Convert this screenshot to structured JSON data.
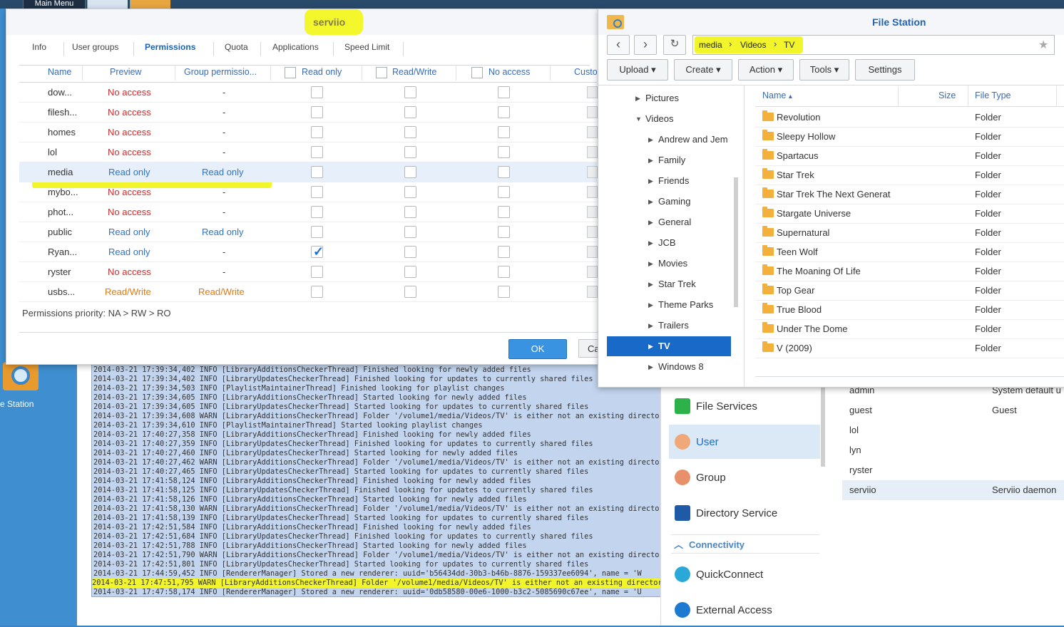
{
  "desktop": {
    "main_menu_label": "Main Menu",
    "file_station_label": "e Station"
  },
  "user_dialog": {
    "title": "serviio",
    "tabs": [
      "Info",
      "User groups",
      "Permissions",
      "Quota",
      "Applications",
      "Speed Limit"
    ],
    "active_tab": "Permissions",
    "columns": {
      "name": "Name",
      "preview": "Preview",
      "group": "Group permissio...",
      "read_only": "Read only",
      "read_write": "Read/Write",
      "no_access": "No access",
      "custom": "Custo"
    },
    "rows": [
      {
        "name": "dow...",
        "preview": "No access",
        "preview_type": "noacc",
        "group": "-",
        "group_type": "dash",
        "ro_checked": false
      },
      {
        "name": "filesh...",
        "preview": "No access",
        "preview_type": "noacc",
        "group": "-",
        "group_type": "dash",
        "ro_checked": false
      },
      {
        "name": "homes",
        "preview": "No access",
        "preview_type": "noacc",
        "group": "-",
        "group_type": "dash",
        "ro_checked": false
      },
      {
        "name": "lol",
        "preview": "No access",
        "preview_type": "noacc",
        "group": "-",
        "group_type": "dash",
        "ro_checked": false
      },
      {
        "name": "media",
        "preview": "Read only",
        "preview_type": "ro",
        "group": "Read only",
        "group_type": "ro",
        "ro_checked": false
      },
      {
        "name": "mybo...",
        "preview": "No access",
        "preview_type": "noacc",
        "group": "-",
        "group_type": "dash",
        "ro_checked": false
      },
      {
        "name": "phot...",
        "preview": "No access",
        "preview_type": "noacc",
        "group": "-",
        "group_type": "dash",
        "ro_checked": false
      },
      {
        "name": "public",
        "preview": "Read only",
        "preview_type": "ro",
        "group": "Read only",
        "group_type": "ro",
        "ro_checked": false
      },
      {
        "name": "Ryan...",
        "preview": "Read only",
        "preview_type": "ro",
        "group": "-",
        "group_type": "dash",
        "ro_checked": true
      },
      {
        "name": "ryster",
        "preview": "No access",
        "preview_type": "noacc",
        "group": "-",
        "group_type": "dash",
        "ro_checked": false
      },
      {
        "name": "usbs...",
        "preview": "Read/Write",
        "preview_type": "rw",
        "group": "Read/Write",
        "group_type": "rw",
        "ro_checked": false
      }
    ],
    "priority_text": "Permissions priority: NA > RW > RO",
    "ok_label": "OK",
    "cancel_label": "Ca"
  },
  "file_station": {
    "title": "File Station",
    "path": [
      "media",
      "Videos",
      "TV"
    ],
    "toolbar": {
      "upload": "Upload",
      "create": "Create",
      "action": "Action",
      "tools": "Tools",
      "settings": "Settings"
    },
    "tree": [
      {
        "label": "Pictures",
        "level": 1,
        "expanded": false
      },
      {
        "label": "Videos",
        "level": 1,
        "expanded": true
      },
      {
        "label": "Andrew and Jem",
        "level": 2,
        "expanded": false
      },
      {
        "label": "Family",
        "level": 2,
        "expanded": false
      },
      {
        "label": "Friends",
        "level": 2,
        "expanded": false
      },
      {
        "label": "Gaming",
        "level": 2,
        "expanded": false
      },
      {
        "label": "General",
        "level": 2,
        "expanded": false
      },
      {
        "label": "JCB",
        "level": 2,
        "expanded": false
      },
      {
        "label": "Movies",
        "level": 2,
        "expanded": false
      },
      {
        "label": "Star Trek",
        "level": 2,
        "expanded": false
      },
      {
        "label": "Theme Parks",
        "level": 2,
        "expanded": false
      },
      {
        "label": "Trailers",
        "level": 2,
        "expanded": false
      },
      {
        "label": "TV",
        "level": 2,
        "expanded": false,
        "selected": true
      },
      {
        "label": "Windows 8",
        "level": 2,
        "expanded": false
      }
    ],
    "columns": {
      "name": "Name",
      "sort_indicator": "▴",
      "size": "Size",
      "type": "File Type"
    },
    "files": [
      {
        "name": "Revolution",
        "type": "Folder"
      },
      {
        "name": "Sleepy Hollow",
        "type": "Folder"
      },
      {
        "name": "Spartacus",
        "type": "Folder"
      },
      {
        "name": "Star Trek",
        "type": "Folder"
      },
      {
        "name": "Star Trek The Next Generat",
        "type": "Folder"
      },
      {
        "name": "Stargate Universe",
        "type": "Folder"
      },
      {
        "name": "Supernatural",
        "type": "Folder"
      },
      {
        "name": "Teen Wolf",
        "type": "Folder"
      },
      {
        "name": "The Moaning Of Life",
        "type": "Folder"
      },
      {
        "name": "Top Gear",
        "type": "Folder"
      },
      {
        "name": "True Blood",
        "type": "Folder"
      },
      {
        "name": "Under The Dome",
        "type": "Folder"
      },
      {
        "name": "V (2009)",
        "type": "Folder"
      }
    ]
  },
  "control_panel": {
    "items": [
      {
        "label": "File Services",
        "icon": "file-services-icon",
        "active": false
      },
      {
        "label": "User",
        "icon": "user-icon",
        "active": true
      },
      {
        "label": "Group",
        "icon": "group-icon",
        "active": false
      },
      {
        "label": "Directory Service",
        "icon": "directory-service-icon",
        "active": false
      }
    ],
    "section_connectivity": "Connectivity",
    "connectivity_items": [
      {
        "label": "QuickConnect",
        "icon": "quickconnect-icon"
      },
      {
        "label": "External Access",
        "icon": "external-access-icon"
      }
    ],
    "users": [
      {
        "name": "admin",
        "desc": "System default u"
      },
      {
        "name": "guest",
        "desc": "Guest"
      },
      {
        "name": "lol",
        "desc": ""
      },
      {
        "name": "lyn",
        "desc": ""
      },
      {
        "name": "ryster",
        "desc": ""
      },
      {
        "name": "serviio",
        "desc": "Serviio daemon",
        "selected": true
      }
    ]
  },
  "log": {
    "lines": [
      {
        "text": "2014-03-21 17:39:34,402 INFO  [LibraryAdditionsCheckerThread] Finished looking for newly added files",
        "hl": false
      },
      {
        "text": "2014-03-21 17:39:34,402 INFO  [LibraryUpdatesCheckerThread] Finished looking for updates to currently shared files",
        "hl": false
      },
      {
        "text": "2014-03-21 17:39:34,503 INFO  [PlaylistMaintainerThread] Finished looking for playlist changes",
        "hl": false
      },
      {
        "text": "2014-03-21 17:39:34,605 INFO  [LibraryAdditionsCheckerThread] Started looking for newly added files",
        "hl": false
      },
      {
        "text": "2014-03-21 17:39:34,605 INFO  [LibraryUpdatesCheckerThread] Started looking for updates to currently shared files",
        "hl": false
      },
      {
        "text": "2014-03-21 17:39:34,608 WARN  [LibraryAdditionsCheckerThread] Folder '/volume1/media/Videos/TV' is either not an existing directory o",
        "hl": false
      },
      {
        "text": "2014-03-21 17:39:34,610 INFO  [PlaylistMaintainerThread] Started looking playlist changes",
        "hl": false
      },
      {
        "text": "2014-03-21 17:40:27,358 INFO  [LibraryAdditionsCheckerThread] Finished looking for newly added files",
        "hl": false
      },
      {
        "text": "2014-03-21 17:40:27,359 INFO  [LibraryUpdatesCheckerThread] Finished looking for updates to currently shared files",
        "hl": false
      },
      {
        "text": "2014-03-21 17:40:27,460 INFO  [LibraryUpdatesCheckerThread] Started looking for newly added files",
        "hl": false
      },
      {
        "text": "2014-03-21 17:40:27,462 WARN  [LibraryAdditionsCheckerThread] Folder '/volume1/media/Videos/TV' is either not an existing directory o",
        "hl": false
      },
      {
        "text": "2014-03-21 17:40:27,465 INFO  [LibraryUpdatesCheckerThread] Started looking for updates to currently shared files",
        "hl": false
      },
      {
        "text": "2014-03-21 17:41:58,124 INFO  [LibraryAdditionsCheckerThread] Finished looking for newly added files",
        "hl": false
      },
      {
        "text": "2014-03-21 17:41:58,125 INFO  [LibraryUpdatesCheckerThread] Finished looking for updates to currently shared files",
        "hl": false
      },
      {
        "text": "2014-03-21 17:41:58,126 INFO  [LibraryAdditionsCheckerThread] Started looking for newly added files",
        "hl": false
      },
      {
        "text": "2014-03-21 17:41:58,130 WARN  [LibraryAdditionsCheckerThread] Folder '/volume1/media/Videos/TV' is either not an existing directory o",
        "hl": false
      },
      {
        "text": "2014-03-21 17:41:58,139 INFO  [LibraryUpdatesCheckerThread] Started looking for updates to currently shared files",
        "hl": false
      },
      {
        "text": "2014-03-21 17:42:51,584 INFO  [LibraryAdditionsCheckerThread] Finished looking for newly added files",
        "hl": false
      },
      {
        "text": "2014-03-21 17:42:51,684 INFO  [LibraryUpdatesCheckerThread] Finished looking for updates to currently shared files",
        "hl": false
      },
      {
        "text": "2014-03-21 17:42:51,788 INFO  [LibraryAdditionsCheckerThread] Started looking for newly added files",
        "hl": false
      },
      {
        "text": "2014-03-21 17:42:51,790 WARN  [LibraryAdditionsCheckerThread] Folder '/volume1/media/Videos/TV' is either not an existing directory o",
        "hl": false
      },
      {
        "text": "2014-03-21 17:42:51,801 INFO  [LibraryUpdatesCheckerThread] Started looking for updates to currently shared files",
        "hl": false
      },
      {
        "text": "2014-03-21 17:44:59,452 INFO  [RendererManager] Stored a new renderer: uuid='b56434dd-30b3-b46b-8876-159337ee6094', name = 'W",
        "hl": false
      },
      {
        "text": "2014-03-21 17:47:51,795 WARN  [LibraryAdditionsCheckerThread] Folder '/volume1/media/Videos/TV' is either not an existing directory o",
        "hl": true
      },
      {
        "text": "2014-03-21 17:47:58,174 INFO  [RendererManager] Stored a new renderer: uuid='0db58580-00e6-1000-b3c2-5085690c67ee', name = 'U",
        "hl": false
      }
    ]
  }
}
